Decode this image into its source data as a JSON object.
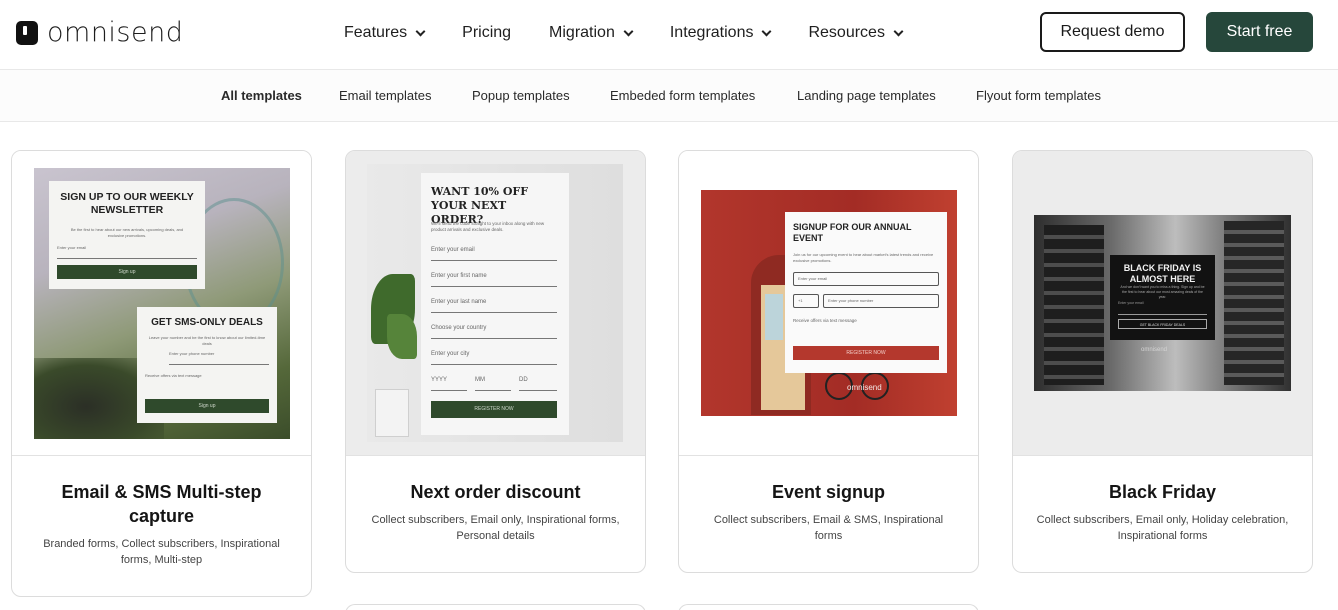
{
  "brand": {
    "name": "omnisend"
  },
  "nav": {
    "items": [
      {
        "label": "Features",
        "has_dropdown": true
      },
      {
        "label": "Pricing",
        "has_dropdown": false
      },
      {
        "label": "Migration",
        "has_dropdown": true
      },
      {
        "label": "Integrations",
        "has_dropdown": true
      },
      {
        "label": "Resources",
        "has_dropdown": true
      }
    ],
    "request_demo": "Request demo",
    "start_free": "Start free"
  },
  "tabs": [
    {
      "label": "All templates",
      "active": true
    },
    {
      "label": "Email templates",
      "active": false
    },
    {
      "label": "Popup templates",
      "active": false
    },
    {
      "label": "Embeded form templates",
      "active": false
    },
    {
      "label": "Landing page templates",
      "active": false
    },
    {
      "label": "Flyout form templates",
      "active": false
    }
  ],
  "cards": [
    {
      "title": "Email & SMS Multi-step capture",
      "tags": "Branded forms, Collect subscribers, Inspirational forms, Multi-step",
      "preview": {
        "heading": "SIGN UP TO OUR WEEKLY NEWSLETTER",
        "subtext": "Be the first to hear about our new arrivals, upcoming deals, and exclusive promotions.",
        "email_placeholder": "Enter your email",
        "button": "Sign up",
        "sms_heading": "GET SMS-ONLY DEALS",
        "sms_subtext": "Leave your number and be the first to know about our limited-time deals",
        "phone_placeholder": "Enter your phone number",
        "checkbox_label": "Receive offers via text message",
        "sms_button": "Sign up"
      }
    },
    {
      "title": "Next order discount",
      "tags": "Collect subscribers, Email only, Inspirational forms, Personal details",
      "preview": {
        "heading": "WANT 10% OFF YOUR NEXT ORDER?",
        "subtext": "We'll send the code straight to your inbox along with new product arrivals and exclusive deals.",
        "fields": [
          "Enter your email",
          "Enter your first name",
          "Enter your last name",
          "Choose your country",
          "Enter your city"
        ],
        "date": [
          "YYYY",
          "MM",
          "DD"
        ],
        "button": "REGISTER NOW"
      }
    },
    {
      "title": "Event signup",
      "tags": "Collect subscribers, Email & SMS, Inspirational forms",
      "preview": {
        "heading": "SIGNUP FOR OUR ANNUAL EVENT",
        "subtext": "Join us for our upcoming event to hear about market's latest trends and receive exclusive promotions.",
        "email_placeholder": "Enter your email",
        "phone_prefix": "+1",
        "phone_placeholder": "Enter your phone number",
        "checkbox_label": "Receive offers via text message",
        "button": "REGISTER NOW",
        "watermark": "omnisend"
      }
    },
    {
      "title": "Black Friday",
      "tags": "Collect subscribers, Email only, Holiday celebration, Inspirational forms",
      "preview": {
        "heading": "BLACK FRIDAY IS ALMOST HERE",
        "subtext": "And we don't want you to miss a thing. Sign up and be the first to hear about our most amazing deals of the year.",
        "email_placeholder": "Enter your email",
        "button": "GET BLACK FRIDAY DEALS",
        "watermark": "omnisend"
      }
    }
  ]
}
